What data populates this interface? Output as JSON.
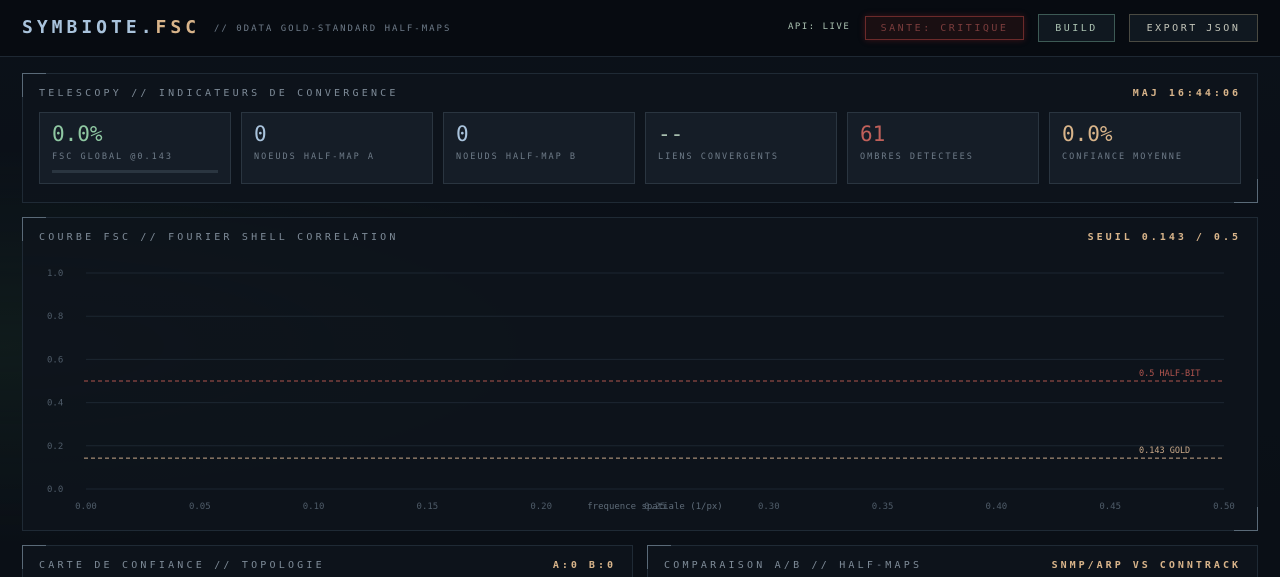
{
  "header": {
    "brand_main": "SYMBIOTE.",
    "brand_accent": "FSC",
    "subtitle": "// 0DATA GOLD-STANDARD HALF-MAPS",
    "api_status": "API: LIVE",
    "health_button": "SANTE: CRITIQUE",
    "build_button": "BUILD",
    "export_button": "EXPORT JSON"
  },
  "telescopy": {
    "title": "TELESCOPY // INDICATEURS DE CONVERGENCE",
    "updated": "MAJ 16:44:06",
    "metrics": [
      {
        "value": "0.0%",
        "label": "FSC GLOBAL @0.143",
        "color": "#8fc8a2",
        "progress": 0
      },
      {
        "value": "0",
        "label": "NOEUDS HALF-MAP A",
        "color": "#a9c3dc"
      },
      {
        "value": "0",
        "label": "NOEUDS HALF-MAP B",
        "color": "#a9c3dc"
      },
      {
        "value": "--",
        "label": "LIENS CONVERGENTS",
        "color": "#a9c0b0"
      },
      {
        "value": "61",
        "label": "OMBRES DETECTEES",
        "color": "#c0605a"
      },
      {
        "value": "0.0%",
        "label": "CONFIANCE MOYENNE",
        "color": "#d8b48a"
      }
    ]
  },
  "fsc": {
    "title": "COURBE FSC // FOURIER SHELL CORRELATION",
    "threshold_label": "SEUIL 0.143 / 0.5"
  },
  "chart_data": {
    "type": "line",
    "title": "",
    "xlabel": "frequence spatiale (1/px)",
    "ylabel": "",
    "xlim": [
      0,
      0.5
    ],
    "ylim": [
      0,
      1
    ],
    "x_ticks": [
      "0.00",
      "0.05",
      "0.10",
      "0.15",
      "0.20",
      "0.25",
      "0.30",
      "0.35",
      "0.40",
      "0.45",
      "0.50"
    ],
    "y_ticks": [
      "0.0",
      "0.2",
      "0.4",
      "0.6",
      "0.8",
      "1.0"
    ],
    "grid": true,
    "series": [],
    "thresholds": [
      {
        "y": 0.5,
        "label": "0.5 HALF-BIT",
        "color": "#b0544e"
      },
      {
        "y": 0.143,
        "label": "0.143 GOLD",
        "color": "#c8a888"
      }
    ]
  },
  "confidence_panel": {
    "title": "CARTE DE CONFIANCE // TOPOLOGIE",
    "counts": "A:0 B:0"
  },
  "comparison_panel": {
    "title": "COMPARAISON A/B // HALF-MAPS",
    "mode": "SNMP/ARP VS CONNTRACK"
  }
}
